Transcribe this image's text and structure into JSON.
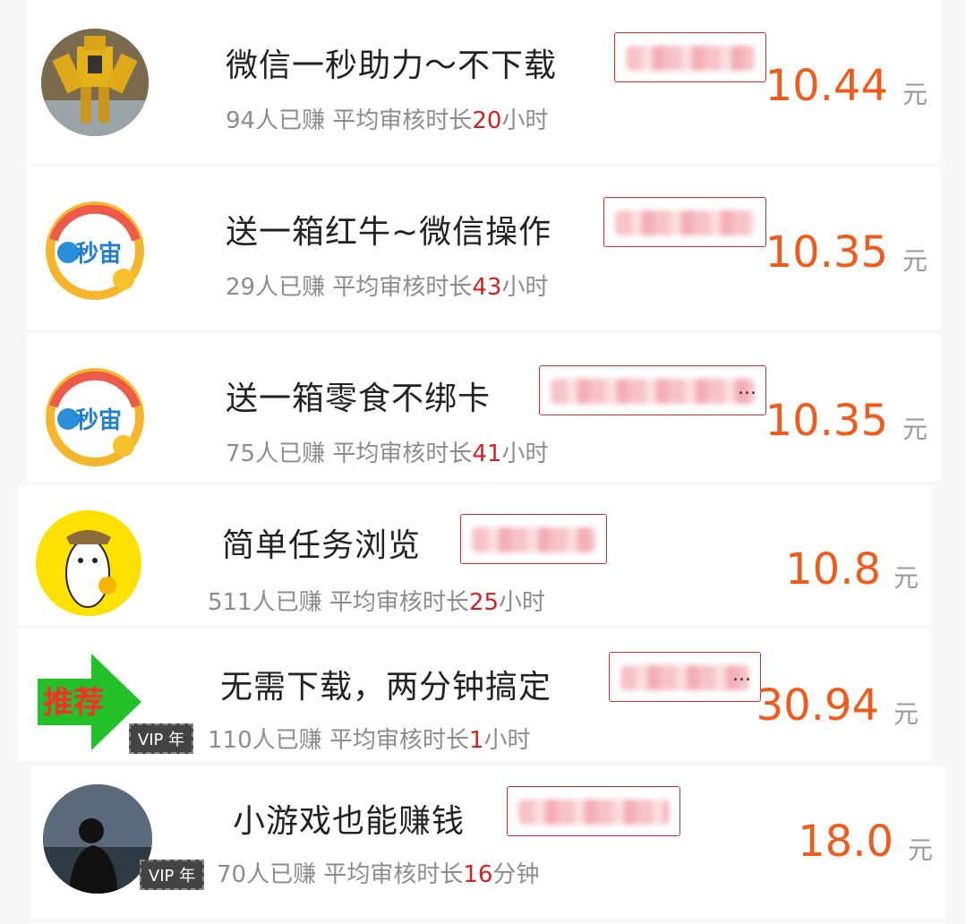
{
  "unit": "元",
  "stat_earned_suffix": "人已赚",
  "stat_review_prefix": "平均审核时长",
  "vip_badge": "VIP 年",
  "colors": {
    "price": "#f05a1a",
    "highlight": "#d61f1f",
    "tag_border": "#d62a2a"
  },
  "tasks": [
    {
      "avatar": "transformer-robot-photo",
      "title": "微信一秒助力～不下载",
      "earned": "94",
      "review_time": "20",
      "review_unit": "小时",
      "price": "10.44",
      "vip": false
    },
    {
      "avatar": "miaozhou-logo",
      "title": "送一箱红牛~微信操作",
      "earned": "29",
      "review_time": "43",
      "review_unit": "小时",
      "price": "10.35",
      "vip": false
    },
    {
      "avatar": "miaozhou-logo",
      "title": "送一箱零食不绑卡",
      "earned": "75",
      "review_time": "41",
      "review_unit": "小时",
      "price": "10.35",
      "vip": false
    },
    {
      "avatar": "cartoon-character",
      "title": "简单任务浏览",
      "earned": "511",
      "review_time": "25",
      "review_unit": "小时",
      "price": "10.8",
      "vip": false
    },
    {
      "avatar": "recommend-arrow",
      "avatar_text": "推荐",
      "title": "无需下载，两分钟搞定",
      "earned": "110",
      "review_time": "1",
      "review_unit": "小时",
      "price": "30.94",
      "vip": true
    },
    {
      "avatar": "person-silhouette-photo",
      "title": "小游戏也能赚钱",
      "earned": "70",
      "review_time": "16",
      "review_unit": "分钟",
      "price": "18.0",
      "vip": true
    }
  ]
}
